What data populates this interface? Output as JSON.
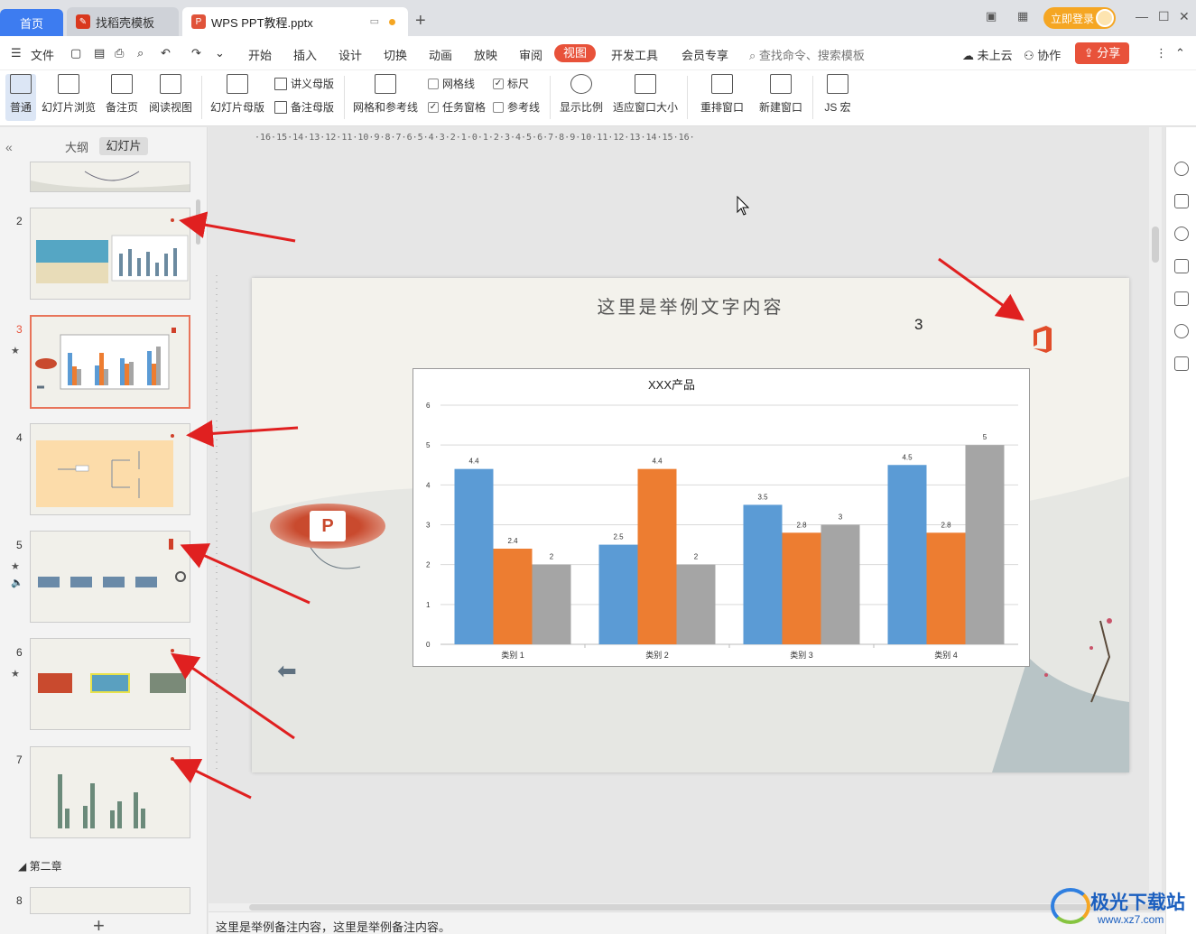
{
  "tabs": {
    "home": "首页",
    "template": "找稻壳模板",
    "file": "WPS PPT教程.pptx",
    "add": "+"
  },
  "window": {
    "login": "立即登录"
  },
  "menu": {
    "file": "文件",
    "items": [
      "开始",
      "插入",
      "设计",
      "切换",
      "动画",
      "放映",
      "审阅",
      "视图",
      "开发工具",
      "会员专享"
    ],
    "active": "视图",
    "search": "查找命令、搜索模板",
    "cloud": "未上云",
    "collab": "协作",
    "share": "分享"
  },
  "ribbon": {
    "normal": "普通",
    "slide_sorter": "幻灯片浏览",
    "notes_page": "备注页",
    "reading_view": "阅读视图",
    "slide_master": "幻灯片母版",
    "handout_master": "讲义母版",
    "notes_master": "备注母版",
    "grid_guides": "网格和参考线",
    "gridlines": "网格线",
    "ruler": "标尺",
    "task_pane": "任务窗格",
    "guides": "参考线",
    "zoom": "显示比例",
    "fit_window": "适应窗口大小",
    "arrange": "重排窗口",
    "new_window": "新建窗口",
    "js_macro": "JS 宏"
  },
  "left_panel": {
    "outline_tab": "大纲",
    "slides_tab": "幻灯片",
    "slide_numbers": [
      "2",
      "3",
      "4",
      "5",
      "6",
      "7",
      "8"
    ],
    "chapter": "第二章",
    "add": "+"
  },
  "slide": {
    "title": "这里是举例文字内容",
    "number": "3"
  },
  "chart_data": {
    "type": "bar",
    "title": "XXX产品",
    "categories": [
      "类别 1",
      "类别 2",
      "类别 3",
      "类别 4"
    ],
    "series": [
      {
        "values": [
          4.4,
          2.5,
          3.5,
          4.5
        ],
        "color": "#5b9bd5"
      },
      {
        "values": [
          2.4,
          4.4,
          2.8,
          2.8
        ],
        "color": "#ed7d31"
      },
      {
        "values": [
          2,
          2,
          3,
          5
        ],
        "color": "#a5a5a5"
      }
    ],
    "ylim": [
      0,
      6
    ],
    "yticks": [
      "0",
      "1",
      "2",
      "3",
      "4",
      "5",
      "6"
    ],
    "grid": true
  },
  "ruler": {
    "h_labels": "·16·15·14·13·12·11·10·9·8·7·6·5·4·3·2·1·0·1·2·3·4·5·6·7·8·9·10·11·12·13·14·15·16·"
  },
  "notes": {
    "text": "这里是举例备注内容，这里是举例备注内容。"
  },
  "watermark": {
    "name": "极光下载站",
    "url": "www.xz7.com"
  }
}
